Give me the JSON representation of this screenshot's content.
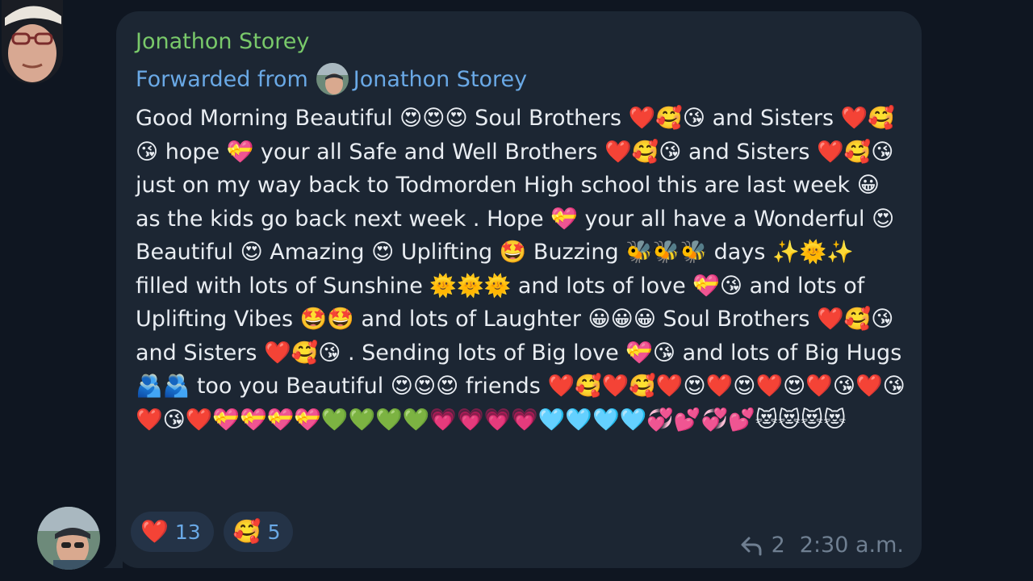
{
  "message": {
    "sender_name": "Jonathon Storey",
    "forwarded_label": "Forwarded from",
    "forwarded_from_name": "Jonathon Storey",
    "body": "Good Morning Beautiful 😍😍😍 Soul Brothers ❤️🥰😘 and Sisters ❤️🥰😘 hope 💝 your all Safe and Well Brothers ❤️🥰😘 and Sisters ❤️🥰😘 just on my way back to Todmorden High school this are last week 😀 as the kids go back next week . Hope 💝 your all have a Wonderful 😍 Beautiful 😍 Amazing 😍 Uplifting 🤩 Buzzing 🐝🐝🐝 days ✨🌞✨ filled with lots of Sunshine 🌞🌞🌞 and lots of love 💝😘 and lots of Uplifting Vibes 🤩🤩 and lots of Laughter 😀😀😀 Soul Brothers ❤️🥰😘 and Sisters ❤️🥰😘 . Sending lots of Big love 💝😘 and lots of Big Hugs 🫂🫂 too you Beautiful 😍😍😍 friends ❤️🥰❤️🥰❤️😍❤️😍❤️😍❤️😘❤️😘❤️😘❤️💝💝💝💝💚💚💚💚💗💗💗💗🩵🩵🩵🩵💞💕💞💕😻😻😻😻",
    "reactions": [
      {
        "emoji": "❤️",
        "count": "13"
      },
      {
        "emoji": "🥰",
        "count": "5"
      }
    ],
    "reply_count": "2",
    "time": "2:30 a.m."
  },
  "icons": {
    "reply": "reply-arrow-icon",
    "avatar_top": "user-avatar-cap-glasses",
    "avatar_bottom": "user-avatar-photo"
  },
  "colors": {
    "background": "#0f1621",
    "bubble": "#1c2633",
    "sender_name": "#79c96a",
    "forwarded": "#6aa9e6",
    "text": "#e9edf2",
    "meta": "#6f7f91",
    "reaction_bg": "#243347"
  }
}
